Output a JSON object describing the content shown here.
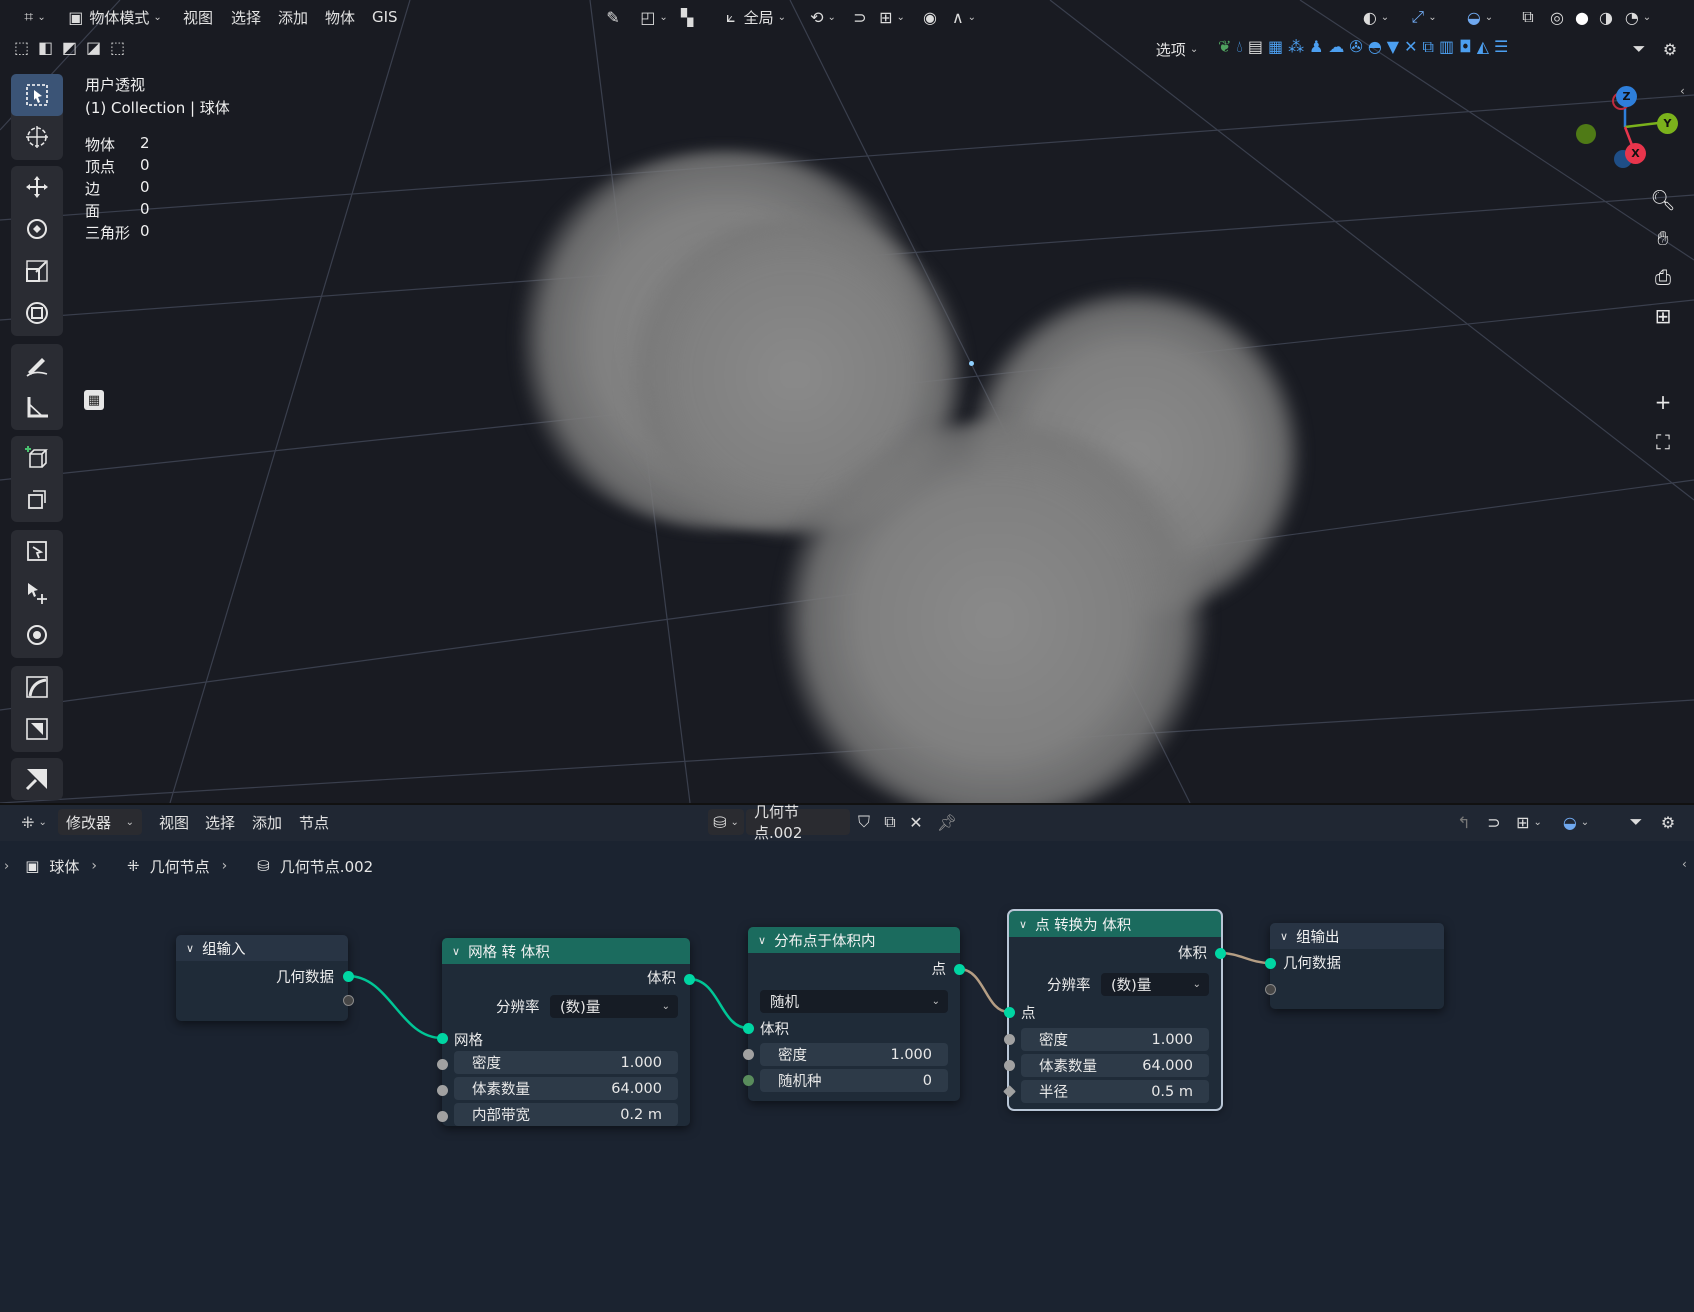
{
  "viewport": {
    "header": {
      "mode": "物体模式",
      "menus": [
        "视图",
        "选择",
        "添加",
        "物体",
        "GIS"
      ],
      "transform_orientation": "全局",
      "options": "选项"
    },
    "overlay": {
      "view_name": "用户透视",
      "collection": "(1) Collection | 球体"
    },
    "stats": [
      {
        "label": "物体",
        "value": "2"
      },
      {
        "label": "顶点",
        "value": "0"
      },
      {
        "label": "边",
        "value": "0"
      },
      {
        "label": "面",
        "value": "0"
      },
      {
        "label": "三角形",
        "value": "0"
      }
    ],
    "gizmo": {
      "x": "X",
      "y": "Y",
      "z": "Z"
    },
    "colors": {
      "x_axis": "#e8354c",
      "y_axis": "#7bb21c",
      "z_axis": "#2e7fdb",
      "active_tool": "#3b5476"
    }
  },
  "node_editor": {
    "header": {
      "editor_type": "修改器",
      "menus": [
        "视图",
        "选择",
        "添加",
        "节点"
      ],
      "node_group_name": "几何节点.002"
    },
    "breadcrumb": [
      "球体",
      "几何节点",
      "几何节点.002"
    ],
    "nodes": {
      "group_input": {
        "title": "组输入",
        "out_geometry": "几何数据"
      },
      "mesh_to_volume": {
        "title": "网格 转 体积",
        "out_volume": "体积",
        "resolution_label": "分辨率",
        "resolution_value": "(数)量",
        "in_mesh": "网格",
        "density_label": "密度",
        "density_value": "1.000",
        "voxel_amount_label": "体素数量",
        "voxel_amount_value": "64.000",
        "interior_band_label": "内部带宽",
        "interior_band_value": "0.2 m"
      },
      "distribute_points": {
        "title": "分布点于体积内",
        "out_points": "点",
        "mode_value": "随机",
        "in_volume": "体积",
        "density_label": "密度",
        "density_value": "1.000",
        "seed_label": "随机种",
        "seed_value": "0"
      },
      "points_to_volume": {
        "title": "点 转换为 体积",
        "out_volume": "体积",
        "resolution_label": "分辨率",
        "resolution_value": "(数)量",
        "in_points": "点",
        "density_label": "密度",
        "density_value": "1.000",
        "voxel_amount_label": "体素数量",
        "voxel_amount_value": "64.000",
        "radius_label": "半径",
        "radius_value": "0.5 m"
      },
      "group_output": {
        "title": "组输出",
        "in_geometry": "几何数据"
      }
    },
    "colors": {
      "geometry_socket": "#00d6a3",
      "node_header": "#1b6b5e",
      "background": "#1b2330"
    }
  }
}
